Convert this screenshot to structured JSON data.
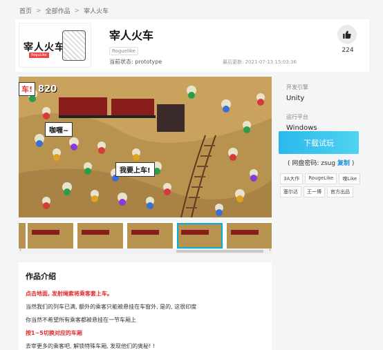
{
  "breadcrumb": [
    "首页",
    "全部作品",
    "宰人火车"
  ],
  "game": {
    "title": "宰人火车",
    "tag": "Roguelike",
    "status": "当前状态: prototype",
    "updated": "最后更新: 2021-07-13 15:03:36",
    "likes": "224",
    "logo_text": "宰人火车",
    "logo_sub": "RoguLike"
  },
  "screenshot": {
    "label": "车!",
    "score": "820",
    "bubble1": "咖喱~",
    "bubble2": "我要上车!"
  },
  "sidebar": {
    "engine_label": "开发引擎",
    "engine": "Unity",
    "platform_label": "运行平台",
    "platform": "Windows",
    "download": "下载试玩",
    "password_prefix": "( 网盘密码: zsug",
    "copy": "复制",
    "password_suffix": ")",
    "tags": [
      "3A大作",
      "RougeLike",
      "魂Like",
      "塞尔达",
      "王一博",
      "官方出品"
    ]
  },
  "intro": {
    "title": "作品介绍",
    "lines": [
      {
        "text": "点击地面, 发射绳索将乘客套上车。",
        "red": true
      },
      {
        "text": "当然我们的列车已满, 额外的乘客只能被悬挂在车窗外, 是的, 这很印度",
        "red": false
      },
      {
        "text": "你当然不希望所有乘客都被悬挂在一节车厢上",
        "red": false
      },
      {
        "text": "按1~5切换对应的车厢",
        "red": true
      },
      {
        "text": "去宰更多的乘客吧, 解锁特殊车厢, 发现他们的奥秘! !",
        "red": false
      }
    ]
  },
  "colors": {
    "accent": "#2bb8ec",
    "red": "#e0292b",
    "sand": "#b8924f",
    "train": "#8b1c1c"
  },
  "thumbnails": [
    {
      "selected": false
    },
    {
      "selected": false
    },
    {
      "selected": false
    },
    {
      "selected": false
    },
    {
      "selected": true
    },
    {
      "selected": false
    }
  ]
}
